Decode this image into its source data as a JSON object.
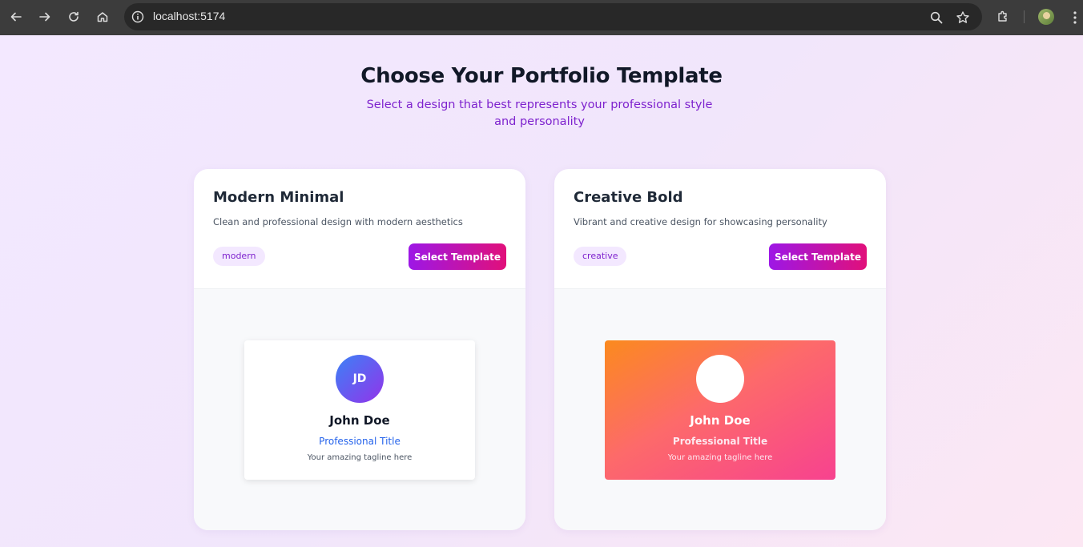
{
  "browser": {
    "url": "localhost:5174"
  },
  "page": {
    "title": "Choose Your Portfolio Template",
    "subtitle": "Select a design that best represents your professional style and personality"
  },
  "templates": [
    {
      "title": "Modern Minimal",
      "description": "Clean and professional design with modern aesthetics",
      "tag": "modern",
      "button_label": "Select Template",
      "preview": {
        "initials": "JD",
        "name": "John Doe",
        "role": "Professional Title",
        "tagline": "Your amazing tagline here"
      }
    },
    {
      "title": "Creative Bold",
      "description": "Vibrant and creative design for showcasing personality",
      "tag": "creative",
      "button_label": "Select Template",
      "preview": {
        "initials": "",
        "name": "John Doe",
        "role": "Professional Title",
        "tagline": "Your amazing tagline here"
      }
    }
  ],
  "colors": {
    "accent_start": "#9d17e6",
    "accent_end": "#e1107a",
    "subtitle": "#7e22ce",
    "background": "#f3e8ff"
  }
}
